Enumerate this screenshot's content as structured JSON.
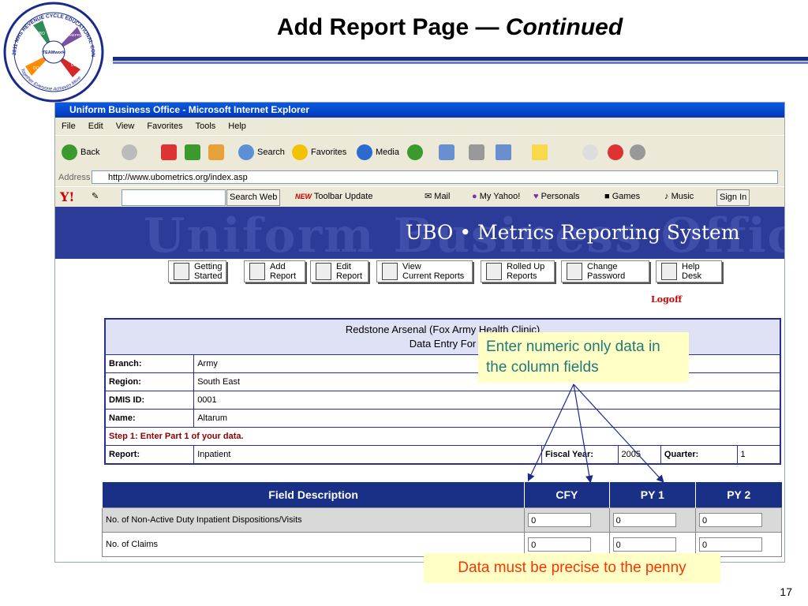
{
  "slide": {
    "title_main": "Add Report Page — ",
    "title_italic": "Continued",
    "slide_number": "17",
    "logo_text": "2011 MHS REVENUE CYCLE EDUCATIONAL CONFERENCE",
    "logo_motto": "Together Everyone Achieves More",
    "logo_center": "TEAMwork",
    "logo_hands": [
      "UBO",
      "MEPRS",
      "UBU",
      "DQ"
    ]
  },
  "browser": {
    "window_title": "Uniform Business Office - Microsoft Internet Explorer",
    "menu": [
      "File",
      "Edit",
      "View",
      "Favorites",
      "Tools",
      "Help"
    ],
    "toolbar": {
      "back": "Back",
      "search": "Search",
      "favorites": "Favorites",
      "media": "Media"
    },
    "address_label": "Address",
    "address_value": "http://www.ubometrics.org/index.asp",
    "yahoo": {
      "logo": "Y!",
      "search_web": "Search Web",
      "new_badge": "NEW",
      "toolbar_update": "Toolbar Update",
      "mail": "Mail",
      "my_yahoo": "My Yahoo!",
      "personals": "Personals",
      "games": "Games",
      "music": "Music",
      "sign_in": "Sign In"
    }
  },
  "page": {
    "banner_bg_text": "Uniform Business Office",
    "banner_title": "UBO • Metrics Reporting System",
    "nav": [
      {
        "line1": "Getting",
        "line2": "Started"
      },
      {
        "line1": "Add",
        "line2": "Report"
      },
      {
        "line1": "Edit",
        "line2": "Report"
      },
      {
        "line1": "View",
        "line2": "Current Reports"
      },
      {
        "line1": "Rolled Up",
        "line2": "Reports"
      },
      {
        "line1": "Change",
        "line2": "Password"
      },
      {
        "line1": "Help",
        "line2": "Desk"
      }
    ],
    "logoff": "Logoff",
    "entry": {
      "facility": "Redstone Arsenal (Fox Army Health Clinic)",
      "form_title": "Data Entry For",
      "rows": [
        {
          "label": "Branch:",
          "value": "Army"
        },
        {
          "label": "Region:",
          "value": "South East"
        },
        {
          "label": "DMIS ID:",
          "value": "0001"
        },
        {
          "label": "Name:",
          "value": "Altarum"
        }
      ],
      "step": "Step 1: Enter Part 1 of your data.",
      "report_label": "Report:",
      "report_value": "Inpatient",
      "fiscal_year_label": "Fiscal Year:",
      "fiscal_year_value": "2005",
      "quarter_label": "Quarter:",
      "quarter_value": "1"
    },
    "fields": {
      "headers": [
        "Field Description",
        "CFY",
        "PY 1",
        "PY 2"
      ],
      "rows": [
        {
          "desc": "No. of Non-Active Duty Inpatient Dispositions/Visits",
          "cfy": "0",
          "py1": "0",
          "py2": "0"
        },
        {
          "desc": "No. of Claims",
          "cfy": "0",
          "py1": "0",
          "py2": "0"
        }
      ]
    }
  },
  "callouts": {
    "numeric": "Enter numeric only data in the column fields",
    "penny": "Data must be precise to the penny"
  }
}
